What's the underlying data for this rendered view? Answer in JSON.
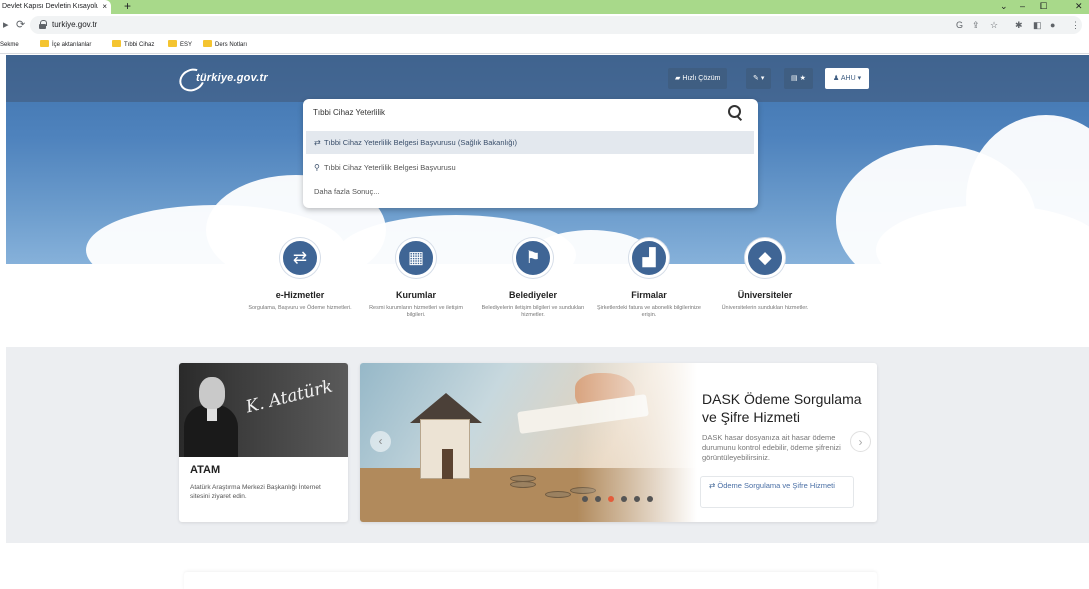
{
  "browser": {
    "tab_title": "Devlet Kapısı Devletin Kısayolu",
    "tab_close": "×",
    "new_tab": "+",
    "url": "turkiye.gov.tr",
    "bookmarks": [
      "Sekme",
      "İçe aktarılanlar",
      "Tıbbi Cihaz",
      "ESY",
      "Ders Notları"
    ],
    "window_controls": {
      "chevron": "⌄",
      "minimize": "–",
      "maximize": "⧠",
      "close": "✕"
    }
  },
  "header": {
    "logo_text": "türkiye.gov.tr",
    "quick_solution": "Hızlı Çözüm",
    "user": "AHU",
    "accent_color": "#3f6595"
  },
  "search": {
    "value": "Tıbbi Cihaz Yeterlilik",
    "suggestions": [
      "Tıbbi Cihaz Yeterlilik Belgesi Başvurusu (Sağlık Bakanlığı)",
      "Tıbbi Cihaz Yeterlilik Belgesi Başvurusu",
      "Daha fazla Sonuç..."
    ]
  },
  "categories": [
    {
      "title": "e-Hizmetler",
      "desc": "Sorgulama, Başvuru ve Ödeme hizmetleri.",
      "icon": "refresh-icon"
    },
    {
      "title": "Kurumlar",
      "desc": "Resmi kurumların hizmetleri ve iletişim bilgileri.",
      "icon": "building-icon"
    },
    {
      "title": "Belediyeler",
      "desc": "Belediyelerin iletişim bilgileri ve sundukları hizmetler.",
      "icon": "signpost-icon"
    },
    {
      "title": "Firmalar",
      "desc": "Şirketlerdeki fatura ve abonelik bilgilerinize erişin.",
      "icon": "factory-icon"
    },
    {
      "title": "Üniversiteler",
      "desc": "Üniversitelerin sundukları hizmetler.",
      "icon": "graduation-cap-icon"
    }
  ],
  "atam": {
    "signature": "K. Atatürk",
    "title": "ATAM",
    "desc": "Atatürk Araştırma Merkezi Başkanlığı İnternet sitesini ziyaret edin."
  },
  "slider": {
    "title": "DASK Ödeme Sorgulama ve Şifre Hizmeti",
    "desc": "DASK hasar dosyanıza ait hasar ödeme durumunu kontrol edebilir, ödeme şifrenizi görüntüleyebilirsiniz.",
    "link": "Ödeme Sorgulama ve Şifre Hizmeti",
    "slide_count": 6,
    "active_slide": 3
  }
}
